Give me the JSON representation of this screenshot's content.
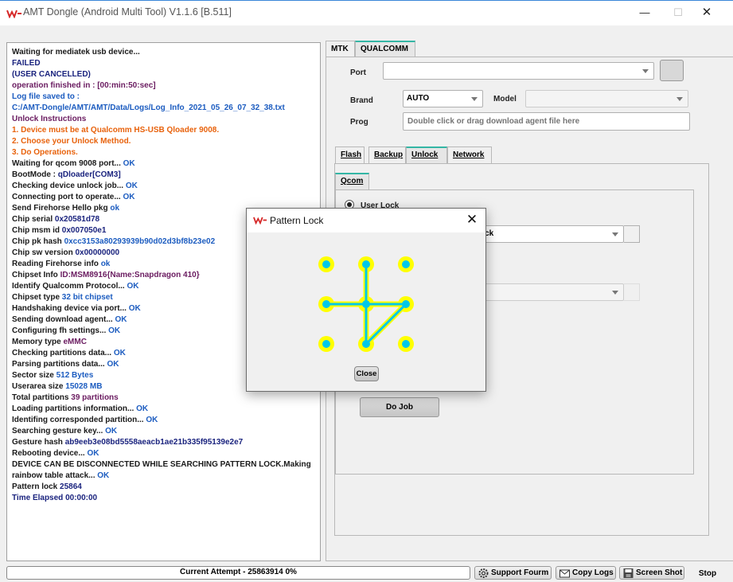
{
  "window": {
    "title": "AMT Dongle (Android Multi Tool) V1.1.6 [B.511]",
    "minimize": "—",
    "maximize": "☐",
    "close": "✕"
  },
  "log": [
    {
      "parts": [
        {
          "t": "Waiting for mediatek usb device...",
          "c": "c-blk"
        }
      ]
    },
    {
      "parts": [
        {
          "t": "FAILED",
          "c": "c-navy"
        }
      ]
    },
    {
      "parts": [
        {
          "t": " (USER CANCELLED)",
          "c": "c-navy"
        }
      ]
    },
    {
      "parts": [
        {
          "t": "operation finished in : [00:min:50:sec]",
          "c": "c-purple"
        }
      ]
    },
    {
      "parts": [
        {
          "t": "Log file saved to :",
          "c": "c-blue"
        }
      ]
    },
    {
      "parts": [
        {
          "t": "C:/AMT-Dongle/AMT/AMT/Data/Logs/Log_Info_2021_05_26_07_32_38.txt",
          "c": "c-blue"
        }
      ]
    },
    {
      "parts": [
        {
          "t": "Unlock Instructions",
          "c": "c-purple"
        }
      ]
    },
    {
      "parts": [
        {
          "t": "1. Device must be at Qualcomm HS-USB Qloader 9008.",
          "c": "c-orange"
        }
      ]
    },
    {
      "parts": [
        {
          "t": "2. Choose your Unlock Method.",
          "c": "c-orange"
        }
      ]
    },
    {
      "parts": [
        {
          "t": "3. Do Operations.",
          "c": "c-orange"
        }
      ]
    },
    {
      "parts": [
        {
          "t": "Waiting for qcom 9008 port... ",
          "c": "c-blk"
        },
        {
          "t": "OK",
          "c": "c-ok"
        }
      ]
    },
    {
      "parts": [
        {
          "t": "BootMode : ",
          "c": "c-blk"
        },
        {
          "t": "qDloader[COM3]",
          "c": "c-navy"
        }
      ]
    },
    {
      "parts": [
        {
          "t": "Checking device unlock job... ",
          "c": "c-blk"
        },
        {
          "t": "OK",
          "c": "c-ok"
        }
      ]
    },
    {
      "parts": [
        {
          "t": "Connecting port to operate... ",
          "c": "c-blk"
        },
        {
          "t": "OK",
          "c": "c-ok"
        }
      ]
    },
    {
      "parts": [
        {
          "t": "Send Firehorse Hello pkg ",
          "c": "c-blk"
        },
        {
          "t": "ok",
          "c": "c-ok"
        }
      ]
    },
    {
      "parts": [
        {
          "t": "Chip serial ",
          "c": "c-blk"
        },
        {
          "t": "0x20581d78",
          "c": "c-navy"
        }
      ]
    },
    {
      "parts": [
        {
          "t": "Chip msm id ",
          "c": "c-blk"
        },
        {
          "t": "0x007050e1",
          "c": "c-navy"
        }
      ]
    },
    {
      "parts": [
        {
          "t": "Chip pk hash ",
          "c": "c-blk"
        },
        {
          "t": "0xcc3153a80293939b90d02d3bf8b23e02",
          "c": "c-blue"
        }
      ]
    },
    {
      "parts": [
        {
          "t": "Chip sw version ",
          "c": "c-blk"
        },
        {
          "t": "0x00000000",
          "c": "c-navy"
        }
      ]
    },
    {
      "parts": [
        {
          "t": "Reading Firehorse info ",
          "c": "c-blk"
        },
        {
          "t": "ok",
          "c": "c-ok"
        }
      ]
    },
    {
      "parts": [
        {
          "t": "Chipset Info ",
          "c": "c-blk"
        },
        {
          "t": "ID:MSM8916{Name:Snapdragon 410}",
          "c": "c-purple"
        }
      ]
    },
    {
      "parts": [
        {
          "t": "Identify Qualcomm Protocol... ",
          "c": "c-blk"
        },
        {
          "t": "OK",
          "c": "c-ok"
        }
      ]
    },
    {
      "parts": [
        {
          "t": "Chipset type ",
          "c": "c-blk"
        },
        {
          "t": "32 bit chipset",
          "c": "c-blue"
        }
      ]
    },
    {
      "parts": [
        {
          "t": "Handshaking device via port... ",
          "c": "c-blk"
        },
        {
          "t": "OK",
          "c": "c-ok"
        }
      ]
    },
    {
      "parts": [
        {
          "t": "Sending download agent... ",
          "c": "c-blk"
        },
        {
          "t": "OK",
          "c": "c-ok"
        }
      ]
    },
    {
      "parts": [
        {
          "t": "Configuring fh settings... ",
          "c": "c-blk"
        },
        {
          "t": "OK",
          "c": "c-ok"
        }
      ]
    },
    {
      "parts": [
        {
          "t": "Memory type ",
          "c": "c-blk"
        },
        {
          "t": "eMMC",
          "c": "c-purple"
        }
      ]
    },
    {
      "parts": [
        {
          "t": "Checking partitions data... ",
          "c": "c-blk"
        },
        {
          "t": "OK",
          "c": "c-ok"
        }
      ]
    },
    {
      "parts": [
        {
          "t": "Parsing partitions data... ",
          "c": "c-blk"
        },
        {
          "t": "OK",
          "c": "c-ok"
        }
      ]
    },
    {
      "parts": [
        {
          "t": "Sector size ",
          "c": "c-blk"
        },
        {
          "t": "512 Bytes",
          "c": "c-blue"
        }
      ]
    },
    {
      "parts": [
        {
          "t": "Userarea size ",
          "c": "c-blk"
        },
        {
          "t": "15028 MB",
          "c": "c-blue"
        }
      ]
    },
    {
      "parts": [
        {
          "t": "Total partitions ",
          "c": "c-blk"
        },
        {
          "t": "39 partitions",
          "c": "c-purple"
        }
      ]
    },
    {
      "parts": [
        {
          "t": "Loading partitions information... ",
          "c": "c-blk"
        },
        {
          "t": "OK",
          "c": "c-ok"
        }
      ]
    },
    {
      "parts": [
        {
          "t": "Identifing corresponded partition... ",
          "c": "c-blk"
        },
        {
          "t": "OK",
          "c": "c-ok"
        }
      ]
    },
    {
      "parts": [
        {
          "t": "Searching gesture key... ",
          "c": "c-blk"
        },
        {
          "t": "OK",
          "c": "c-ok"
        }
      ]
    },
    {
      "parts": [
        {
          "t": "Gesture hash ",
          "c": "c-blk"
        },
        {
          "t": "ab9eeb3e08bd5558aeacb1ae21b335f95139e2e7",
          "c": "c-navy"
        }
      ]
    },
    {
      "parts": [
        {
          "t": "Rebooting device... ",
          "c": "c-blk"
        },
        {
          "t": "OK",
          "c": "c-ok"
        }
      ]
    },
    {
      "parts": [
        {
          "t": "DEVICE CAN BE DISCONNECTED WHILE SEARCHING PATTERN LOCK.Making",
          "c": "c-blk"
        }
      ]
    },
    {
      "parts": [
        {
          "t": "rainbow table attack... ",
          "c": "c-blk"
        },
        {
          "t": "OK",
          "c": "c-ok"
        }
      ]
    },
    {
      "parts": [
        {
          "t": "Pattern lock ",
          "c": "c-blk"
        },
        {
          "t": "25864",
          "c": "c-navy"
        }
      ]
    },
    {
      "parts": [
        {
          "t": "Time Elapsed       00:00:00",
          "c": "c-navy"
        }
      ]
    }
  ],
  "main_tabs": [
    "MTK",
    "QUALCOMM"
  ],
  "form": {
    "port_label": "Port",
    "port_value": "",
    "brand_label": "Brand",
    "brand_value": "AUTO",
    "model_label": "Model",
    "model_value": "",
    "prog_label": "Prog",
    "prog_placeholder": "Double click or drag download agent file here"
  },
  "sub_tabs": [
    "Flash",
    "Backup",
    "Unlock",
    "Network"
  ],
  "qcom_tab": "Qcom",
  "unlock": {
    "radio_label": "User Lock",
    "combo_value_partial": "ock",
    "do_job": "Do Job"
  },
  "dialog": {
    "title": "Pattern Lock",
    "close_button": "Close",
    "close_icon": "✕",
    "pattern_sequence": [
      2,
      5,
      8,
      6,
      4
    ],
    "dot_color": "#ffff00",
    "dot_center_color": "#00c8e8",
    "line_color": "#00c8e8"
  },
  "status": {
    "progress_text": "Current Attempt - 25863914 0%",
    "progress_percent": 0,
    "support_button": "Support Fourm",
    "copy_logs_button": "Copy Logs",
    "screenshot_button": "Screen Shot",
    "stop_button": "Stop"
  },
  "colors": {
    "accent_tab": "#34b6a5",
    "progress_green": "#06b025"
  },
  "icons": {
    "app_logo": "amt-logo-icon",
    "support": "gear-icon",
    "copy_logs": "envelope-icon",
    "screenshot": "floppy-icon"
  }
}
